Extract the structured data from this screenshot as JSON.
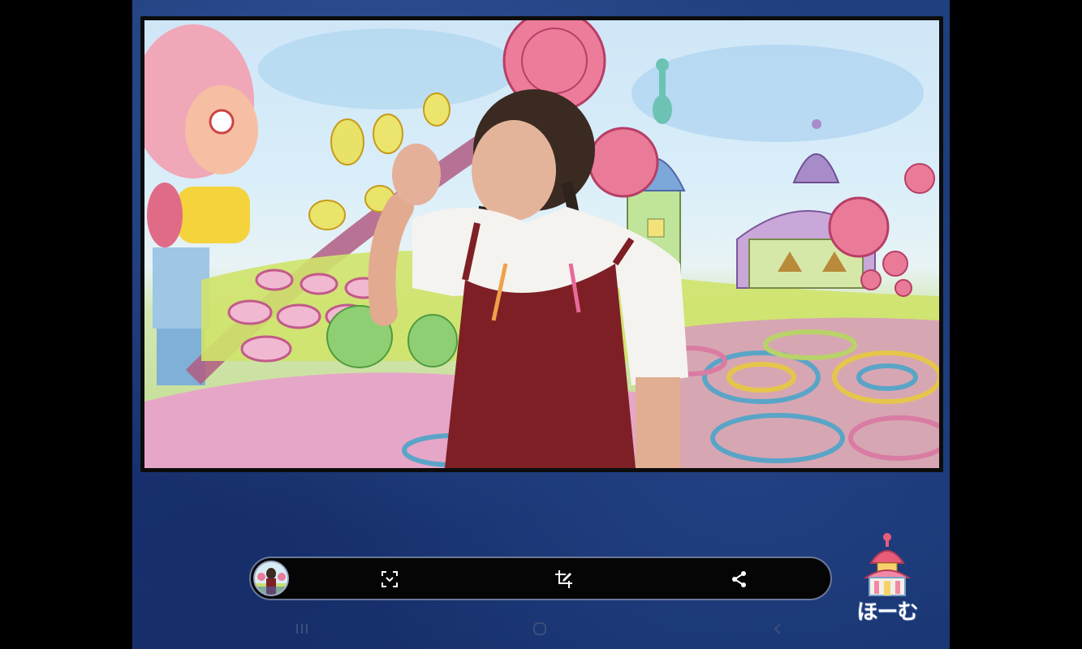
{
  "video": {
    "scene": "storybook-background-with-performer"
  },
  "toolbar": {
    "buttons": [
      {
        "icon": "screenshot-icon"
      },
      {
        "icon": "crop-edit-icon"
      },
      {
        "icon": "share-icon"
      }
    ]
  },
  "home": {
    "label": "ほーむ"
  },
  "navbar": {
    "items": [
      {
        "icon": "recent-apps-icon"
      },
      {
        "icon": "home-icon"
      },
      {
        "icon": "back-icon"
      }
    ]
  },
  "colors": {
    "background": "#1b3a78",
    "toolbar": "#050505",
    "accent_pink": "#e8607c",
    "dress": "#7e1f26"
  }
}
